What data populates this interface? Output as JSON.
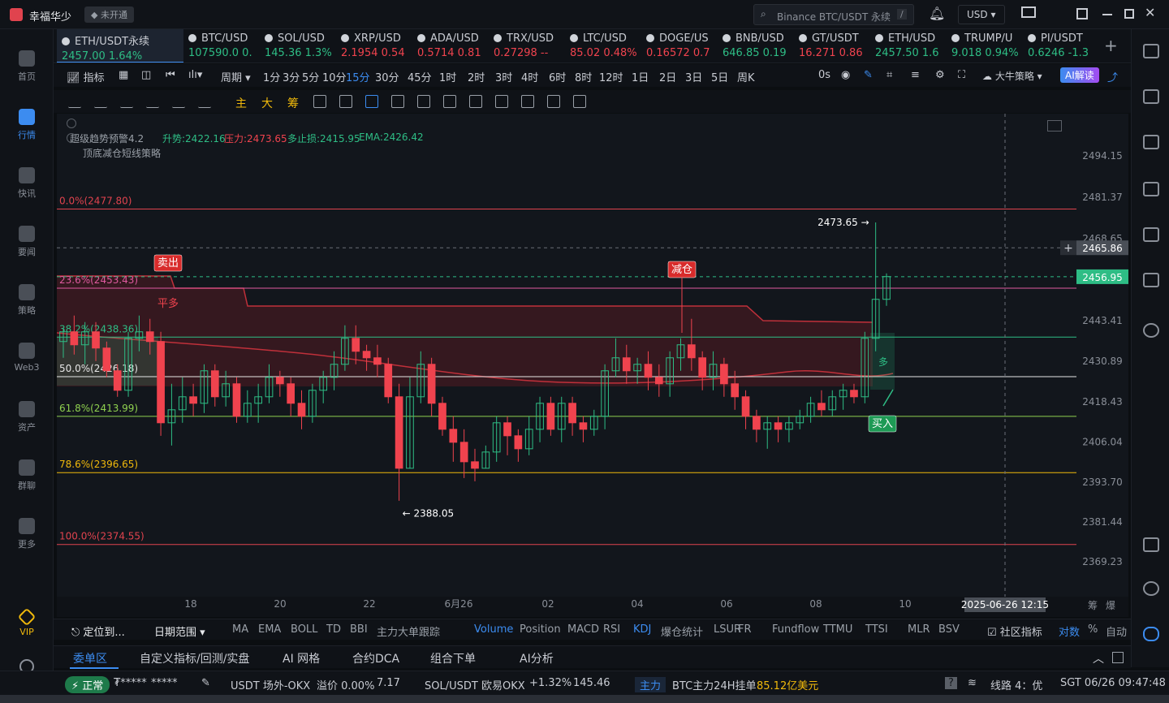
{
  "titlebar": {
    "app_name": "幸福华少",
    "account_status": "未开通",
    "search_placeholder": "Binance BTC/USDT 永续",
    "search_shortcut": "/",
    "currency": "USD"
  },
  "leftnav": [
    {
      "label": "首页",
      "icon": "home-icon"
    },
    {
      "label": "行情",
      "icon": "market-icon",
      "active": true
    },
    {
      "label": "快讯",
      "icon": "news-icon"
    },
    {
      "label": "要闻",
      "icon": "headline-icon"
    },
    {
      "label": "策略",
      "icon": "strategy-icon"
    },
    {
      "label": "Web3",
      "icon": "web3-icon"
    },
    {
      "label": "资产",
      "icon": "wallet-icon"
    },
    {
      "label": "群聊",
      "icon": "chat-icon"
    },
    {
      "label": "更多",
      "icon": "more-icon"
    },
    {
      "label": "VIP",
      "icon": "vip-icon"
    }
  ],
  "tickers": [
    {
      "name": "ETH/USDT永续",
      "price": "2457.00",
      "change": "1.64%",
      "dir": "up",
      "selected": true
    },
    {
      "name": "BTC/USD",
      "price": "107590.0",
      "change": "0.",
      "dir": "up"
    },
    {
      "name": "SOL/USD",
      "price": "145.36",
      "change": "1.3%",
      "dir": "up"
    },
    {
      "name": "XRP/USD",
      "price": "2.1954",
      "change": "0.54",
      "dir": "dn"
    },
    {
      "name": "ADA/USD",
      "price": "0.5714",
      "change": "0.81",
      "dir": "dn"
    },
    {
      "name": "TRX/USD",
      "price": "0.27298",
      "change": "--",
      "dir": "dn"
    },
    {
      "name": "LTC/USD",
      "price": "85.02",
      "change": "0.48%",
      "dir": "dn"
    },
    {
      "name": "DOGE/US",
      "price": "0.16572",
      "change": "0.7",
      "dir": "dn"
    },
    {
      "name": "BNB/USD",
      "price": "646.85",
      "change": "0.19",
      "dir": "up"
    },
    {
      "name": "GT/USDT",
      "price": "16.271",
      "change": "0.86",
      "dir": "dn"
    },
    {
      "name": "ETH/USD",
      "price": "2457.50",
      "change": "1.6",
      "dir": "up"
    },
    {
      "name": "TRUMP/U",
      "price": "9.018",
      "change": "0.94%",
      "dir": "up"
    },
    {
      "name": "PI/USDT",
      "price": "0.6246",
      "change": "-1.3",
      "dir": "up"
    }
  ],
  "timeframes": [
    "1分",
    "3分",
    "5分",
    "10分",
    "15分",
    "30分",
    "45分",
    "1时",
    "2时",
    "3时",
    "4时",
    "6时",
    "8时",
    "12时",
    "1日",
    "2日",
    "3日",
    "5日",
    "周K"
  ],
  "selected_timeframe": "15分",
  "toolbar": {
    "indicator": "指标",
    "period": "周期",
    "countdown": "0s",
    "strategy": "大牛策略",
    "ai": "AI解读"
  },
  "drawbar_labels": [
    "主",
    "大",
    "筹"
  ],
  "indicator_header": {
    "name": "超级趋势预警4.2",
    "up_label": "升势:2422.16",
    "resist_label": "压力:2473.65",
    "stop_label": "多止损:2415.95",
    "ema_label": "EMA:2426.42",
    "strategy": "顶底减仓短线策略"
  },
  "chart_data": {
    "type": "candlestick",
    "symbol": "ETH/USDT永续",
    "interval": "15分",
    "price_axis": [
      "2494.15",
      "2481.37",
      "2468.65",
      "2443.41",
      "2430.89",
      "2418.43",
      "2406.04",
      "2393.70",
      "2381.44",
      "2369.23"
    ],
    "current_price": "2456.95",
    "crosshair_price": "2465.86",
    "crosshair_time": "2025-06-26 12:15",
    "time_axis": [
      "18",
      "20",
      "22",
      "6月26",
      "02",
      "04",
      "06",
      "08",
      "10"
    ],
    "fib_levels": [
      {
        "label": "0.0%(2477.80)",
        "price": 2477.8,
        "color": "#e0434e"
      },
      {
        "label": "23.6%(2453.43)",
        "price": 2453.43,
        "color": "#e05aa0"
      },
      {
        "label": "38.2%(2438.36)",
        "price": 2438.36,
        "color": "#2ebd85"
      },
      {
        "label": "50.0%(2426.18)",
        "price": 2426.18,
        "color": "#e6e6e6"
      },
      {
        "label": "61.8%(2413.99)",
        "price": 2413.99,
        "color": "#8fd14f"
      },
      {
        "label": "78.6%(2396.65)",
        "price": 2396.65,
        "color": "#f0b90b"
      },
      {
        "label": "100.0%(2374.55)",
        "price": 2374.55,
        "color": "#e0434e"
      }
    ],
    "high_label": "2473.65",
    "low_label": "2388.05",
    "signals": [
      "卖出",
      "平多",
      "减仓",
      "买入",
      "多"
    ],
    "candles": [
      [
        2437,
        2440,
        2432,
        2441
      ],
      [
        2440,
        2436,
        2433,
        2445
      ],
      [
        2436,
        2440,
        2430,
        2443
      ],
      [
        2440,
        2435,
        2431,
        2443
      ],
      [
        2435,
        2428,
        2426,
        2437
      ],
      [
        2428,
        2422,
        2420,
        2430
      ],
      [
        2422,
        2438,
        2420,
        2440
      ],
      [
        2438,
        2440,
        2434,
        2445
      ],
      [
        2440,
        2437,
        2433,
        2444
      ],
      [
        2437,
        2412,
        2408,
        2440
      ],
      [
        2412,
        2416,
        2405,
        2424
      ],
      [
        2416,
        2420,
        2412,
        2426
      ],
      [
        2420,
        2418,
        2414,
        2424
      ],
      [
        2418,
        2428,
        2415,
        2430
      ],
      [
        2428,
        2420,
        2417,
        2430
      ],
      [
        2420,
        2424,
        2417,
        2428
      ],
      [
        2424,
        2414,
        2412,
        2426
      ],
      [
        2414,
        2418,
        2412,
        2422
      ],
      [
        2418,
        2420,
        2412,
        2424
      ],
      [
        2420,
        2426,
        2418,
        2430
      ],
      [
        2426,
        2424,
        2420,
        2428
      ],
      [
        2424,
        2418,
        2414,
        2426
      ],
      [
        2418,
        2414,
        2410,
        2422
      ],
      [
        2414,
        2422,
        2412,
        2424
      ],
      [
        2422,
        2426,
        2418,
        2428
      ],
      [
        2426,
        2430,
        2422,
        2434
      ],
      [
        2430,
        2438,
        2428,
        2442
      ],
      [
        2438,
        2434,
        2430,
        2442
      ],
      [
        2434,
        2432,
        2428,
        2436
      ],
      [
        2432,
        2430,
        2426,
        2436
      ],
      [
        2430,
        2420,
        2418,
        2432
      ],
      [
        2420,
        2398,
        2388,
        2424
      ],
      [
        2398,
        2420,
        2398,
        2426
      ],
      [
        2420,
        2430,
        2418,
        2434
      ],
      [
        2430,
        2418,
        2414,
        2432
      ],
      [
        2418,
        2410,
        2408,
        2420
      ],
      [
        2410,
        2406,
        2400,
        2414
      ],
      [
        2406,
        2400,
        2395,
        2410
      ],
      [
        2400,
        2398,
        2394,
        2404
      ],
      [
        2398,
        2403,
        2398,
        2405
      ],
      [
        2403,
        2412,
        2400,
        2414
      ],
      [
        2412,
        2408,
        2402,
        2414
      ],
      [
        2408,
        2404,
        2400,
        2410
      ],
      [
        2404,
        2410,
        2402,
        2414
      ],
      [
        2410,
        2418,
        2406,
        2420
      ],
      [
        2418,
        2410,
        2408,
        2420
      ],
      [
        2410,
        2418,
        2406,
        2420
      ],
      [
        2418,
        2412,
        2408,
        2420
      ],
      [
        2412,
        2410,
        2406,
        2414
      ],
      [
        2410,
        2414,
        2408,
        2416
      ],
      [
        2414,
        2428,
        2410,
        2430
      ],
      [
        2428,
        2432,
        2426,
        2438
      ],
      [
        2432,
        2428,
        2424,
        2436
      ],
      [
        2428,
        2430,
        2424,
        2432
      ],
      [
        2430,
        2426,
        2422,
        2434
      ],
      [
        2426,
        2424,
        2420,
        2430
      ],
      [
        2424,
        2432,
        2420,
        2434
      ],
      [
        2432,
        2436,
        2428,
        2438
      ],
      [
        2436,
        2432,
        2428,
        2444
      ],
      [
        2432,
        2426,
        2422,
        2434
      ],
      [
        2426,
        2430,
        2422,
        2434
      ],
      [
        2430,
        2424,
        2420,
        2432
      ],
      [
        2424,
        2420,
        2416,
        2428
      ],
      [
        2420,
        2414,
        2410,
        2422
      ],
      [
        2414,
        2410,
        2406,
        2416
      ],
      [
        2410,
        2412,
        2404,
        2414
      ],
      [
        2412,
        2410,
        2406,
        2414
      ],
      [
        2410,
        2412,
        2406,
        2414
      ],
      [
        2412,
        2414,
        2410,
        2416
      ],
      [
        2414,
        2418,
        2412,
        2420
      ],
      [
        2418,
        2416,
        2414,
        2422
      ],
      [
        2416,
        2420,
        2414,
        2422
      ],
      [
        2420,
        2422,
        2416,
        2424
      ],
      [
        2422,
        2420,
        2418,
        2424
      ],
      [
        2420,
        2438,
        2418,
        2440
      ],
      [
        2438,
        2450,
        2434,
        2473.65
      ],
      [
        2450,
        2457,
        2448,
        2458
      ]
    ]
  },
  "indicators": [
    "MA",
    "EMA",
    "BOLL",
    "TD",
    "BBI",
    "主力大单跟踪",
    "Volume",
    "Position",
    "MACD",
    "RSI",
    "KDJ",
    "爆仓统计",
    "LSUR",
    "FR",
    "Fundflow",
    "TTMU",
    "TTSI",
    "MLR",
    "BSV"
  ],
  "indicator_left": {
    "locate": "定位到...",
    "range": "日期范围"
  },
  "indicator_right": {
    "community": "社区指标",
    "log": "对数",
    "percent": "%",
    "auto": "自动"
  },
  "panel_tabs": [
    "委单区",
    "自定义指标/回测/实盘",
    "AI 网格",
    "合约DCA",
    "组合下单",
    "AI分析"
  ],
  "statusbar": {
    "status": "正常",
    "mask1": "₮*****",
    "mask2": "*****",
    "otc": "USDT 场外-OKX",
    "premium": "溢价 0.00%",
    "otc_price": "7.17",
    "pair": "SOL/USDT 欧易OKX",
    "pair_change": "+1.32%",
    "pair_price": "145.46",
    "main_tag": "主力",
    "main_text": "BTC主力24H挂单",
    "main_amount": "85.12亿美元",
    "line": "线路 4：优",
    "clock": "SGT 06/26 09:47:48"
  },
  "right_axis_labels": {
    "bottom_left": "筹",
    "bottom_right": "爆"
  }
}
